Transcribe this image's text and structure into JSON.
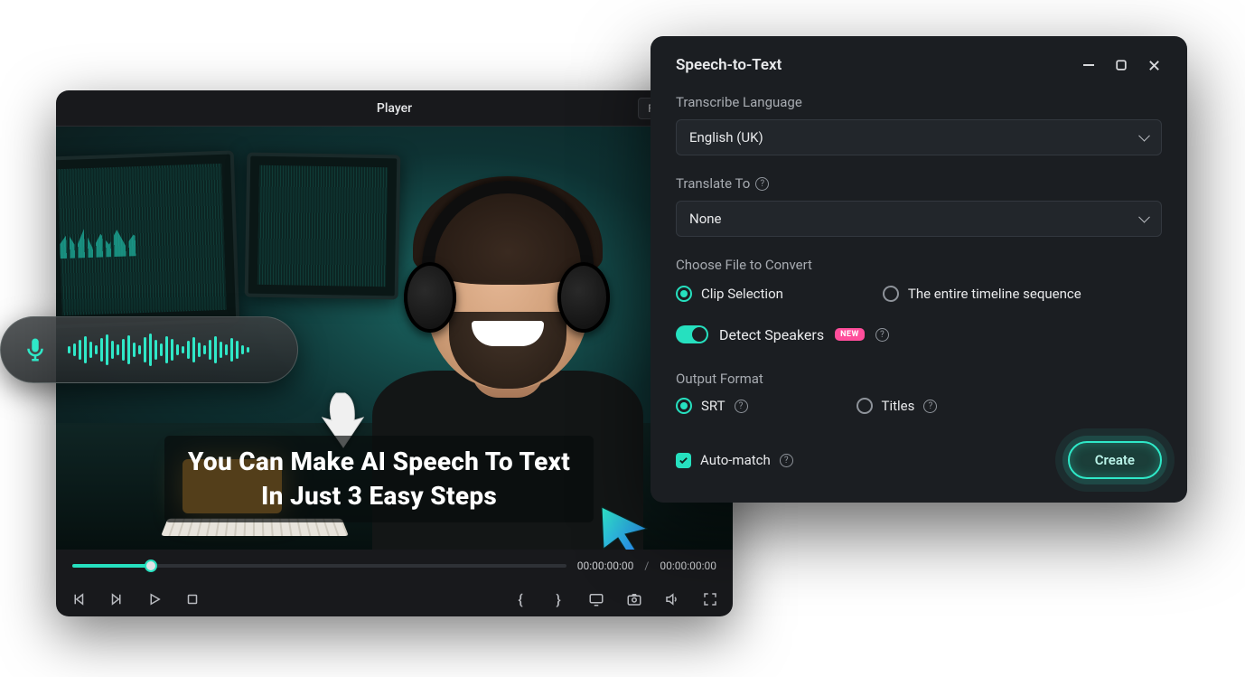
{
  "player": {
    "title": "Player",
    "quality": "Full Quality",
    "caption_line1": "You Can Make AI Speech To Text",
    "caption_line2": "In Just  3 Easy Steps",
    "time_current": "00:00:00:00",
    "time_separator": "/",
    "time_total": "00:00:00:00"
  },
  "stt": {
    "title": "Speech-to-Text",
    "transcribe_label": "Transcribe Language",
    "transcribe_value": "English (UK)",
    "translate_label": "Translate To",
    "translate_value": "None",
    "choose_file_label": "Choose File to Convert",
    "option_clip": "Clip Selection",
    "option_timeline": "The entire timeline sequence",
    "detect_label": "Detect Speakers",
    "new_badge": "NEW",
    "output_label": "Output Format",
    "format_srt": "SRT",
    "format_titles": "Titles",
    "auto_match": "Auto-match",
    "create": "Create"
  }
}
